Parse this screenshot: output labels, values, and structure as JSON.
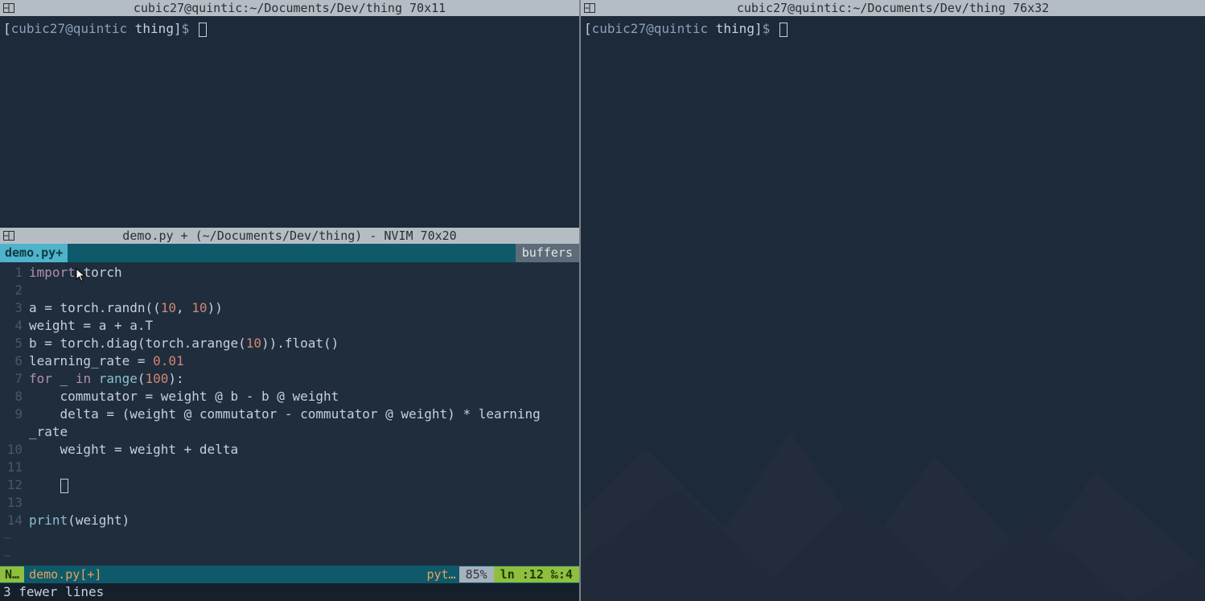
{
  "panes": {
    "upper_left": {
      "title": "cubic27@quintic:~/Documents/Dev/thing 70x11",
      "prompt_user": "cubic27@quintic",
      "prompt_dir": "thing",
      "prompt_symbol": "$"
    },
    "right": {
      "title": "cubic27@quintic:~/Documents/Dev/thing 76x32",
      "prompt_user": "cubic27@quintic",
      "prompt_dir": "thing",
      "prompt_symbol": "$"
    },
    "nvim": {
      "title": "demo.py + (~/Documents/Dev/thing) - NVIM 70x20",
      "tab_active": "demo.py+",
      "tab_right": "buffers",
      "lines": {
        "l1": {
          "num": "1",
          "import": "import",
          "mod": "torch"
        },
        "l2": {
          "num": "2",
          "text": ""
        },
        "l3": {
          "num": "3",
          "pre": "a = torch.randn((",
          "n1": "10",
          "mid": ", ",
          "n2": "10",
          "post": "))"
        },
        "l4": {
          "num": "4",
          "text": "weight = a + a.T"
        },
        "l5": {
          "num": "5",
          "pre": "b = torch.diag(torch.arange(",
          "n": "10",
          "post": ")).float()"
        },
        "l6": {
          "num": "6",
          "pre": "learning_rate = ",
          "n": "0.01"
        },
        "l7": {
          "num": "7",
          "for": "for",
          "var": " _ ",
          "in": "in",
          "rng": " range",
          "open": "(",
          "n": "100",
          "close": "):"
        },
        "l8": {
          "num": "8",
          "text": "    commutator = weight @ b - b @ weight"
        },
        "l9": {
          "num": "9",
          "text": "    delta = (weight @ commutator - commutator @ weight) * learning"
        },
        "l9b": {
          "num": "",
          "text": "_rate"
        },
        "l10": {
          "num": "10",
          "text": "    weight = weight + delta"
        },
        "l11": {
          "num": "11",
          "text": ""
        },
        "l12": {
          "num": "12",
          "text": "    "
        },
        "l13": {
          "num": "13",
          "text": ""
        },
        "l14": {
          "num": "14",
          "fn": "print",
          "open": "(",
          "arg": "weight",
          "close": ")"
        }
      },
      "status": {
        "mode": "N…",
        "file": "demo.py[+]",
        "filetype": "pyt…",
        "percent": "85%",
        "position": "ln :12 ‰:4"
      },
      "message": "3 fewer lines"
    }
  }
}
